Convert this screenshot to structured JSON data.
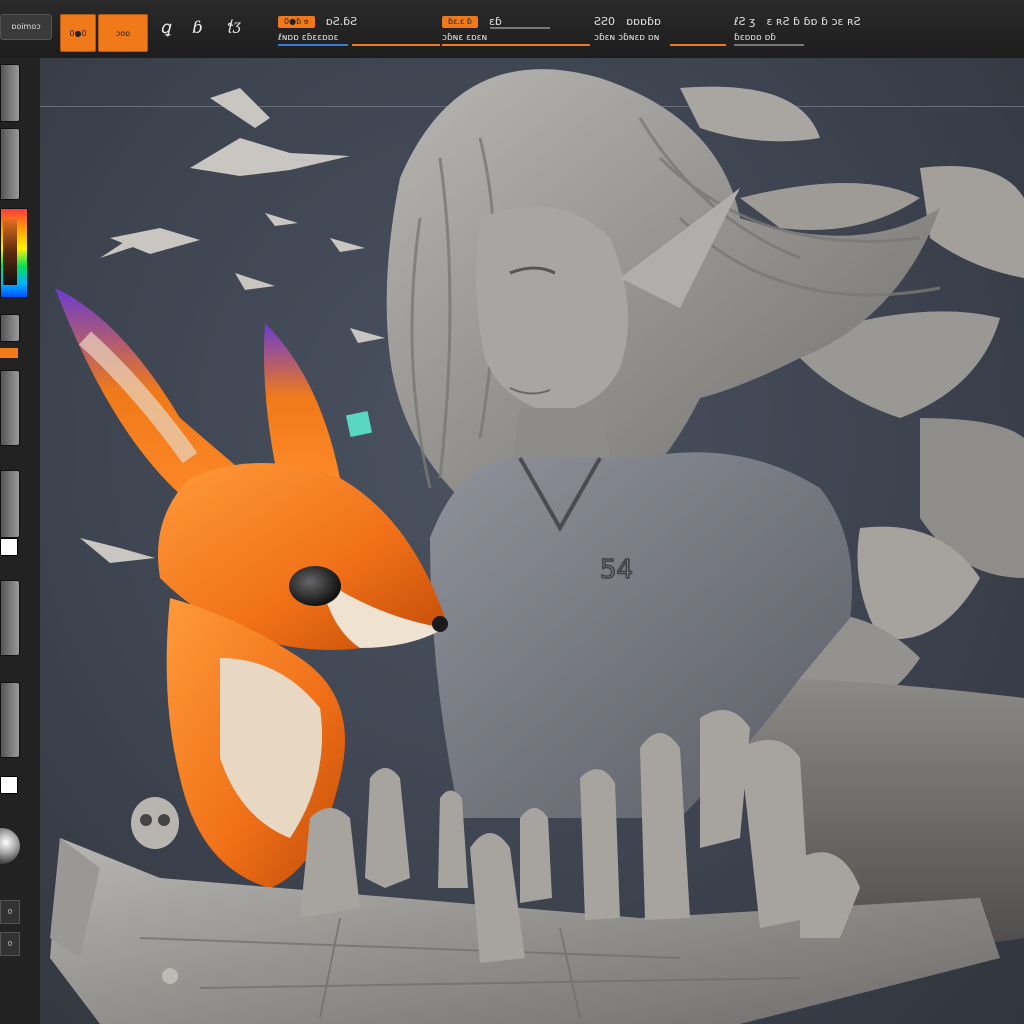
{
  "app": {
    "menu_label": "ɒoimoɔ",
    "accent_color": "#f07a1a",
    "background_color": "#2b2d31"
  },
  "toolbar": {
    "buttons": [
      {
        "label": "0●0",
        "icon": "brush-mode-icon"
      },
      {
        "label": "ɔoɒ",
        "icon": "edit-mode-icon"
      }
    ],
    "tools": [
      {
        "icon": "stroke-tool-icon",
        "glyph": "ꝗ"
      },
      {
        "icon": "sculpt-tool-icon",
        "glyph": "ɓ"
      },
      {
        "icon": "signature-tool-icon",
        "glyph": "ꞎʒ"
      }
    ],
    "groups": [
      {
        "chip": "0●ɓ ɘ",
        "label": "ɒƧ.ɓƧ",
        "sub": "ℓɴɒɒ  ɛɓɛɛɒɒɛ"
      },
      {
        "chip": "ɓɛ.ɛ ɓ",
        "label": "ɛɓ",
        "sub": "ɔɓɴɛ  ɛɒɛɴ"
      },
      {
        "chip": "ƧƧ0",
        "label": "ɒɒɒɓɒ",
        "sub": "ɔɓɛɴ  ɔɓɴɛɒ  ɒɴ"
      },
      {
        "chip": "ℓƧ ʒ",
        "label": "ɛ ʀƧ ɓ ɓɒ ɓ ɔɛ ʀƧ",
        "sub": "ɓɛɒɒɒ ɒɓ"
      }
    ]
  },
  "viewport": {
    "shirt_number": "54"
  },
  "sidebar": {
    "buttons": [
      "0",
      "0"
    ]
  }
}
